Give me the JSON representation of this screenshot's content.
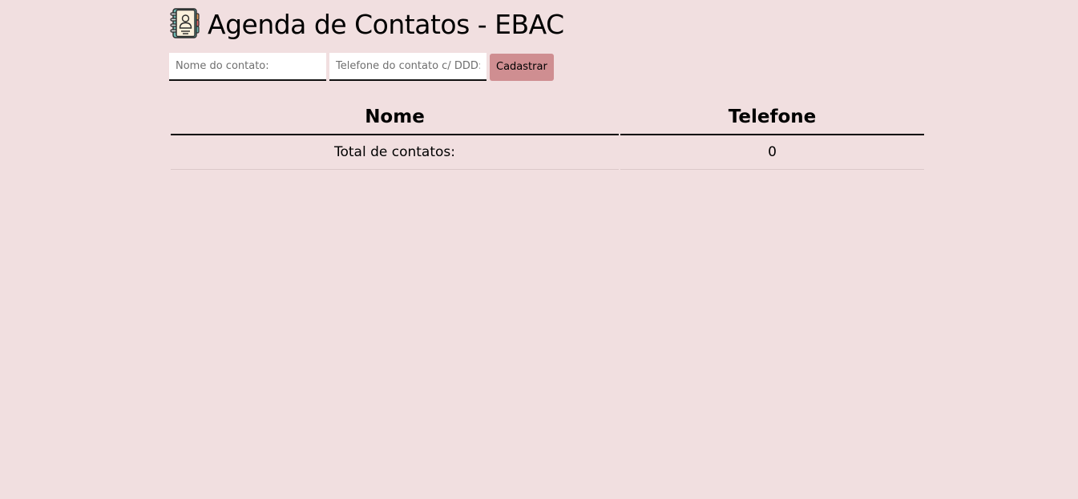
{
  "header": {
    "icon": "address-book-icon",
    "title": "Agenda de Contatos - EBAC"
  },
  "form": {
    "name_placeholder": "Nome do contato:",
    "name_value": "",
    "phone_placeholder": "Telefone do contato c/ DDD:",
    "phone_value": "",
    "submit_label": "Cadastrar"
  },
  "table": {
    "headers": [
      "Nome",
      "Telefone"
    ],
    "rows": [],
    "footer": {
      "label": "Total de contatos:",
      "total": "0"
    }
  },
  "colors": {
    "background": "#f1dfe0",
    "button": "#cf8e91"
  }
}
